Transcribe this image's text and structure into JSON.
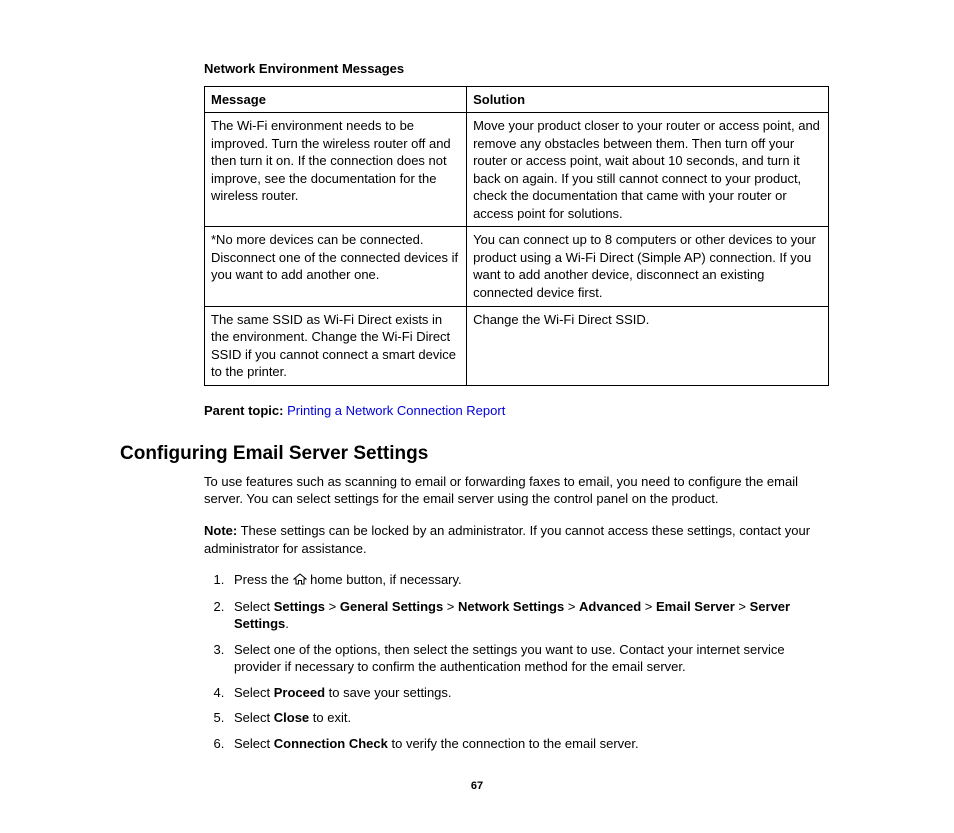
{
  "tableTitle": "Network Environment Messages",
  "headers": {
    "message": "Message",
    "solution": "Solution"
  },
  "rows": [
    {
      "message": "The Wi-Fi environment needs to be improved. Turn the wireless router off and then turn it on. If the connection does not improve, see the documentation for the wireless router.",
      "solution": "Move your product closer to your router or access point, and remove any obstacles between them. Then turn off your router or access point, wait about 10 seconds, and turn it back on again. If you still cannot connect to your product, check the documentation that came with your router or access point for solutions."
    },
    {
      "message": "*No more devices can be connected. Disconnect one of the connected devices if you want to add another one.",
      "solution": "You can connect up to 8 computers or other devices to your product using a Wi-Fi Direct (Simple AP) connection. If you want to add another device, disconnect an existing connected device first."
    },
    {
      "message": "The same SSID as Wi-Fi Direct exists in the environment. Change the Wi-Fi Direct SSID if you cannot connect a smart device to the printer.",
      "solution": "Change the Wi-Fi Direct SSID."
    }
  ],
  "parentTopic": {
    "label": "Parent topic:",
    "link": "Printing a Network Connection Report"
  },
  "sectionHeading": "Configuring Email Server Settings",
  "intro": "To use features such as scanning to email or forwarding faxes to email, you need to configure the email server. You can select settings for the email server using the control panel on the product.",
  "note": {
    "label": "Note:",
    "text": " These settings can be locked by an administrator. If you cannot access these settings, contact your administrator for assistance."
  },
  "steps": {
    "s1a": "Press the ",
    "s1b": " home button, if necessary.",
    "s2a": "Select ",
    "s2_settings": "Settings",
    "gt": " > ",
    "s2_general": "General Settings",
    "s2_network": "Network Settings",
    "s2_advanced": "Advanced",
    "s2_email": "Email Server",
    "s2_server": "Server Settings",
    "period": ".",
    "s3": "Select one of the options, then select the settings you want to use. Contact your internet service provider if necessary to confirm the authentication method for the email server.",
    "s4a": "Select ",
    "s4b": "Proceed",
    "s4c": " to save your settings.",
    "s5a": "Select ",
    "s5b": "Close",
    "s5c": " to exit.",
    "s6a": "Select ",
    "s6b": "Connection Check",
    "s6c": " to verify the connection to the email server."
  },
  "pageNumber": "67"
}
